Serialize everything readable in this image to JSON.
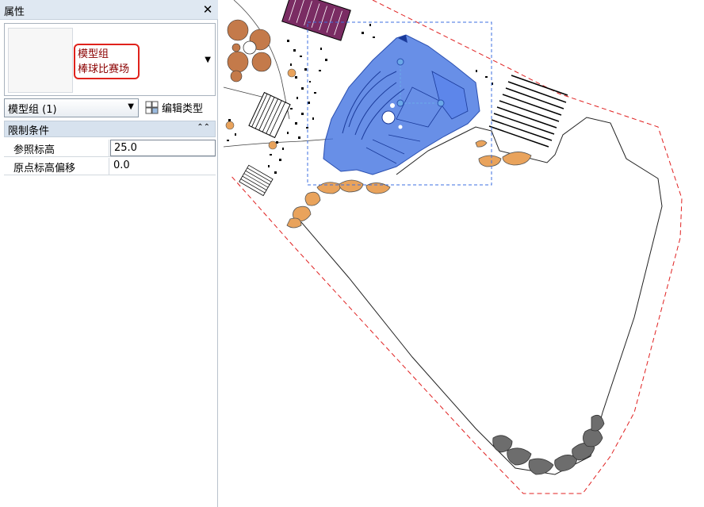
{
  "panel": {
    "title": "属性",
    "close_glyph": "✕",
    "type_selector": {
      "family": "模型组",
      "type": "棒球比赛场"
    },
    "instance_selector": "模型组 (1)",
    "edit_type_label": "编辑类型",
    "group": {
      "title": "限制条件",
      "collapse_glyph": "⌃⌃"
    },
    "properties": [
      {
        "name": "参照标高",
        "value": "25.0"
      },
      {
        "name": "原点标高偏移",
        "value": "0.0"
      }
    ]
  },
  "colors": {
    "selection_blue": "#3d6fe0",
    "boundary_red": "#e02020",
    "rock_orange": "#e9a35c",
    "rock_gray": "#6d6d6d",
    "highlight_red": "#e0221c"
  },
  "icons": {
    "close": "close-icon",
    "dropdown": "chevron-down-icon",
    "edit_type": "edit-type-icon",
    "collapse": "collapse-icon"
  }
}
